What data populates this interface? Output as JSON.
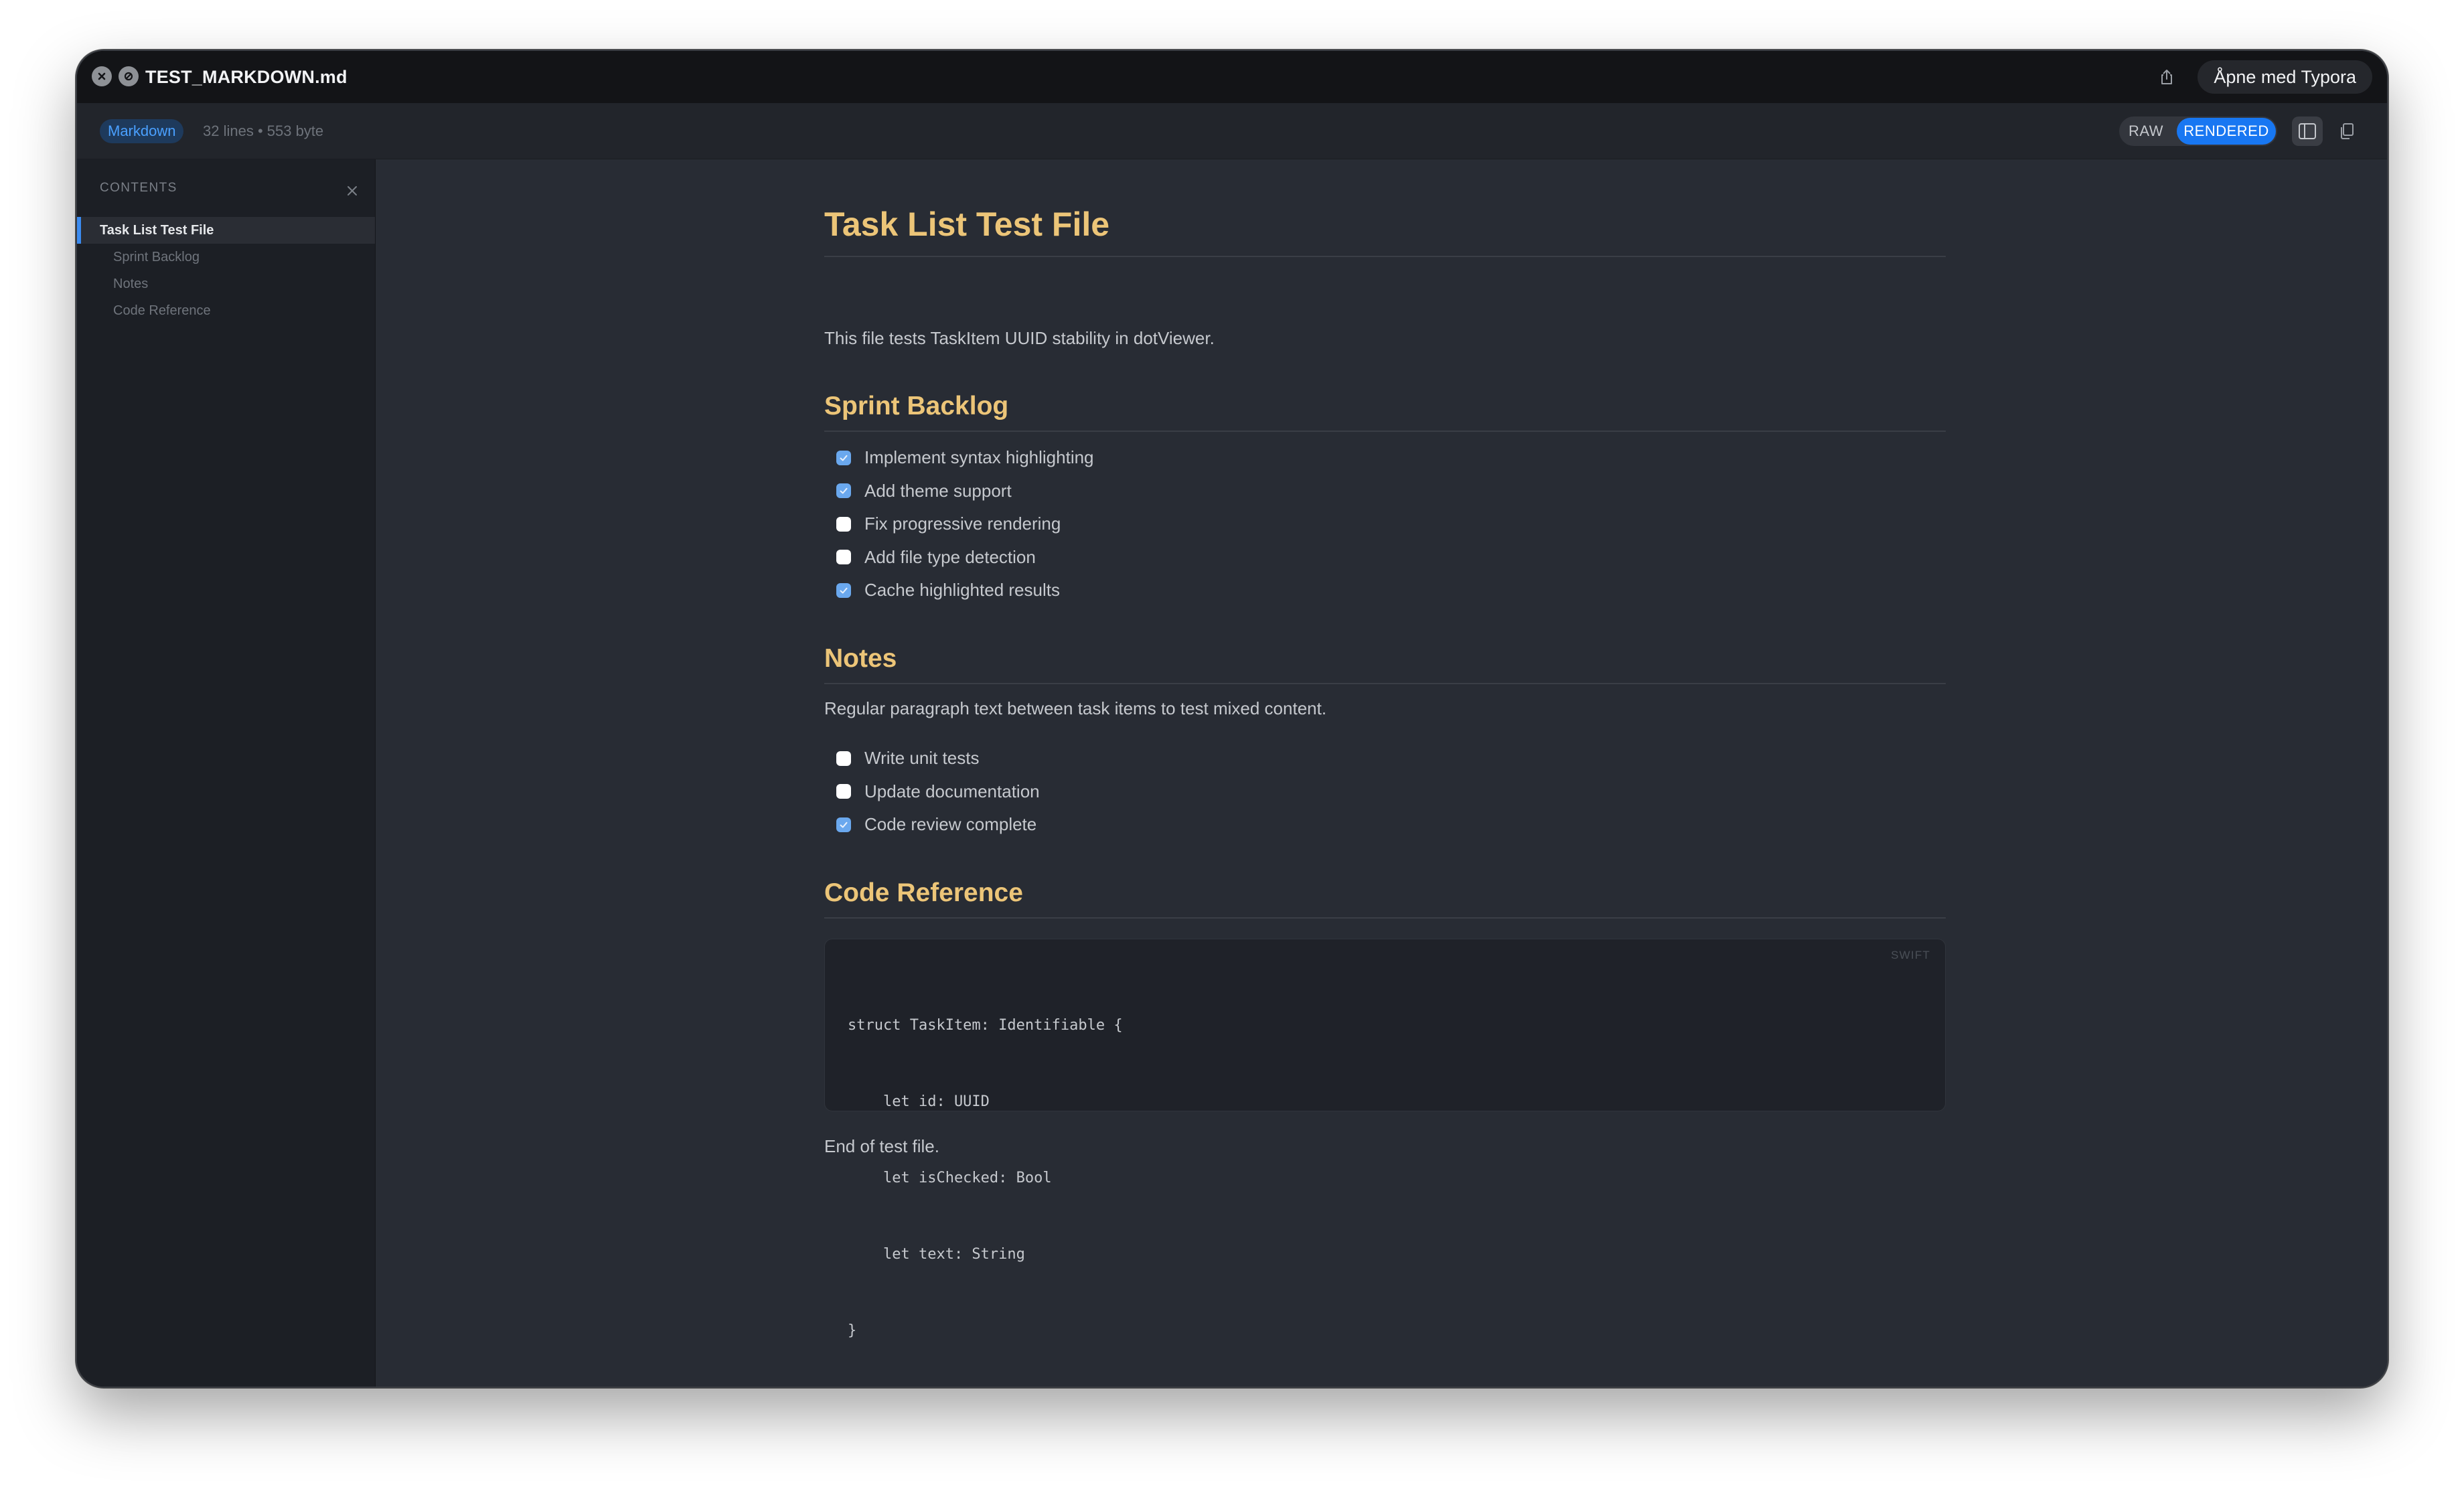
{
  "window": {
    "title": "TEST_MARKDOWN.md",
    "open_with_label": "Åpne med Typora"
  },
  "toolbar": {
    "badge": "Markdown",
    "file_meta": "32 lines • 553 byte",
    "view_modes": [
      "RAW",
      "RENDERED"
    ],
    "active_mode": "RENDERED"
  },
  "sidebar": {
    "header": "CONTENTS",
    "items": [
      {
        "label": "Task List Test File",
        "level": 1,
        "active": true
      },
      {
        "label": "Sprint Backlog",
        "level": 2,
        "active": false
      },
      {
        "label": "Notes",
        "level": 2,
        "active": false
      },
      {
        "label": "Code Reference",
        "level": 2,
        "active": false
      }
    ]
  },
  "document": {
    "title": "Task List Test File",
    "intro": "This file tests TaskItem UUID stability in dotViewer.",
    "sections": [
      {
        "heading": "Sprint Backlog",
        "tasks": [
          {
            "text": "Implement syntax highlighting",
            "checked": true
          },
          {
            "text": "Add theme support",
            "checked": true
          },
          {
            "text": "Fix progressive rendering",
            "checked": false
          },
          {
            "text": "Add file type detection",
            "checked": false
          },
          {
            "text": "Cache highlighted results",
            "checked": true
          }
        ]
      },
      {
        "heading": "Notes",
        "paragraph": "Regular paragraph text between task items to test mixed content.",
        "tasks": [
          {
            "text": "Write unit tests",
            "checked": false
          },
          {
            "text": "Update documentation",
            "checked": false
          },
          {
            "text": "Code review complete",
            "checked": true
          }
        ]
      },
      {
        "heading": "Code Reference",
        "code": {
          "language": "SWIFT",
          "lines": [
            "struct TaskItem: Identifiable {",
            "    let id: UUID",
            "    let isChecked: Bool",
            "    let text: String",
            "}"
          ]
        }
      }
    ],
    "outro": "End of test file."
  },
  "colors": {
    "heading": "#ecc578",
    "accent": "#1877f2",
    "checkbox_checked": "#6aa8ee"
  }
}
